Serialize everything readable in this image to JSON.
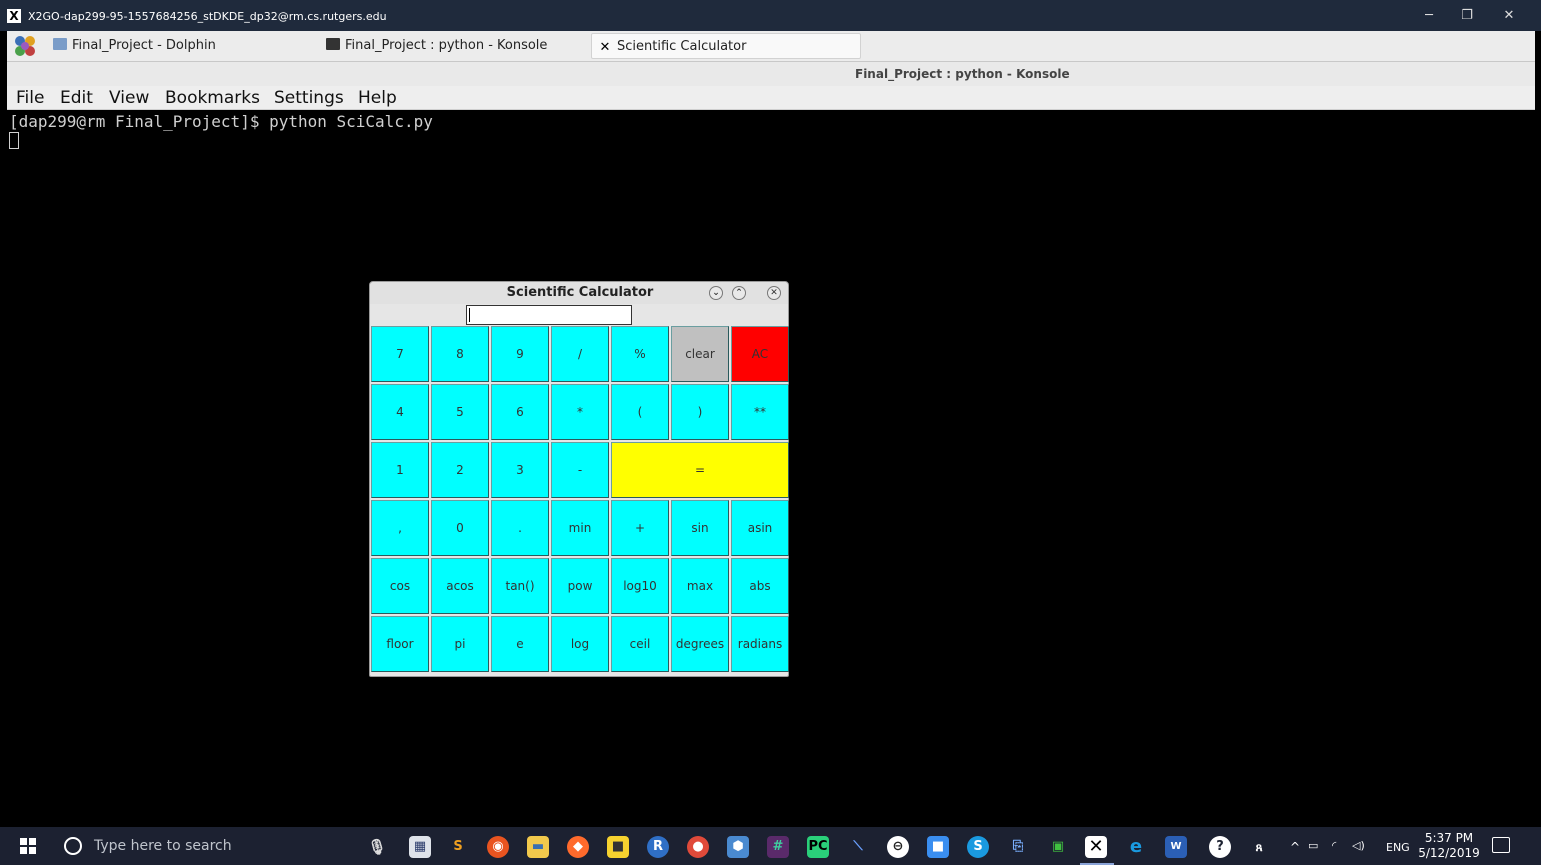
{
  "x2go_window": {
    "title": "X2GO-dap299-95-1557684256_stDKDE_dp32@rm.cs.rutgers.edu",
    "controls": {
      "minimize": "─",
      "maximize": "❐",
      "close": "✕"
    }
  },
  "kde_taskbar": {
    "tasks": [
      {
        "label": "Final_Project - Dolphin",
        "icon": "dolphin-icon"
      },
      {
        "label": "Final_Project : python - Konsole",
        "icon": "konsole-icon"
      },
      {
        "label": "Scientific Calculator",
        "icon": "x-icon"
      }
    ]
  },
  "konsole": {
    "title": "Final_Project : python - Konsole",
    "menu": [
      "File",
      "Edit",
      "View",
      "Bookmarks",
      "Settings",
      "Help"
    ],
    "terminal_line": "[dap299@rm Final_Project]$ python SciCalc.py"
  },
  "calculator": {
    "title": "Scientific Calculator",
    "display_value": "",
    "title_buttons": {
      "minimize": "⌄",
      "maximize": "⌃",
      "close": "✕"
    },
    "rows": [
      [
        "7",
        "8",
        "9",
        "/",
        "%",
        "clear",
        "AC"
      ],
      [
        "4",
        "5",
        "6",
        "*",
        "(",
        ")",
        "**"
      ],
      [
        "1",
        "2",
        "3",
        "-",
        "="
      ],
      [
        ",",
        "0",
        ".",
        "min",
        "+",
        "sin",
        "asin"
      ],
      [
        "cos",
        "acos",
        "tan()",
        "pow",
        "log10",
        "max",
        "abs"
      ],
      [
        "floor",
        "pi",
        "e",
        "log",
        "ceil",
        "degrees",
        "radians"
      ]
    ],
    "colors": {
      "default": "#00ffff",
      "clear": "#c0c0c0",
      "AC": "#ff0000",
      "equals": "#ffff00"
    }
  },
  "windows_taskbar": {
    "search_placeholder": "Type here to search",
    "tray": {
      "language": "ENG",
      "time": "5:37 PM",
      "date": "5/12/2019"
    }
  }
}
